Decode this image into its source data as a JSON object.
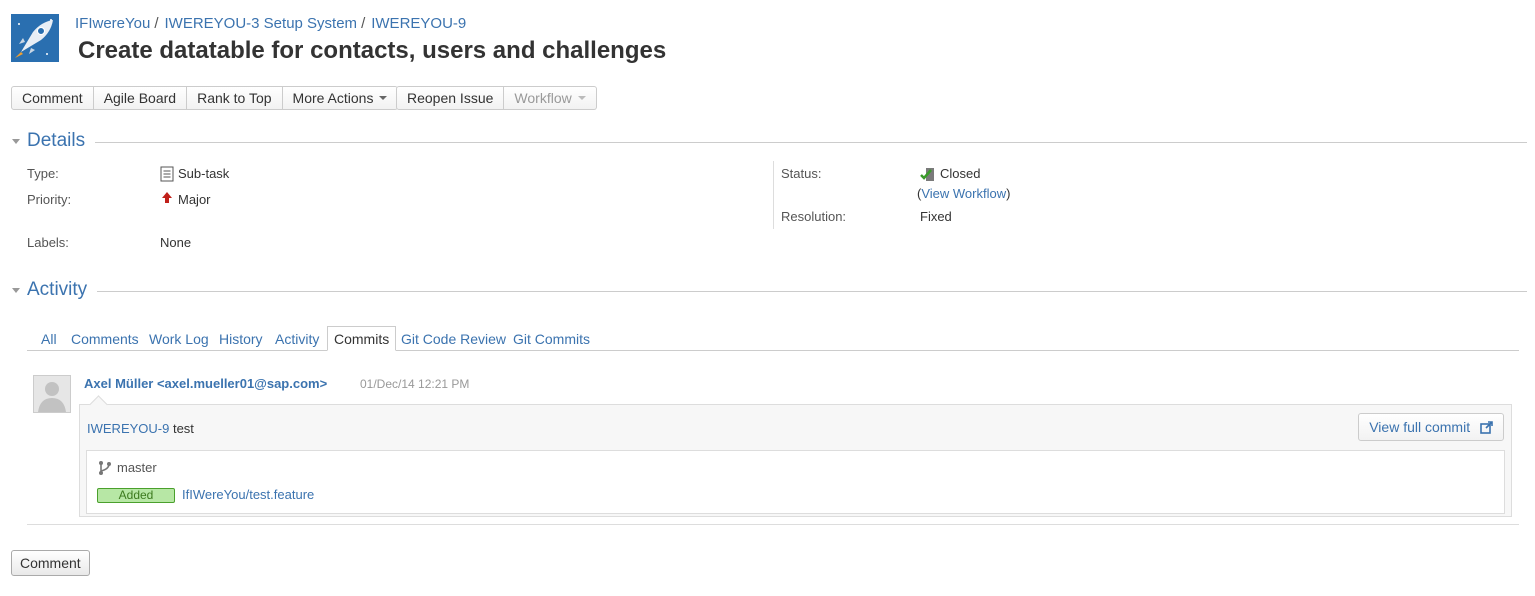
{
  "header": {
    "breadcrumbs": [
      "IFIwereYou",
      "IWEREYOU-3 Setup System",
      "IWEREYOU-9"
    ],
    "separator": "/",
    "title": "Create datatable for contacts, users and challenges"
  },
  "toolbar": {
    "group1": [
      "Comment",
      "Agile Board",
      "Rank to Top",
      "More Actions"
    ],
    "group2": [
      "Reopen Issue",
      "Workflow"
    ]
  },
  "details": {
    "heading": "Details",
    "type_label": "Type:",
    "type_value": "Sub-task",
    "priority_label": "Priority:",
    "priority_value": "Major",
    "labels_label": "Labels:",
    "labels_value": "None",
    "status_label": "Status:",
    "status_value": "Closed",
    "view_workflow_open": "(",
    "view_workflow": "View Workflow",
    "view_workflow_close": ")",
    "resolution_label": "Resolution:",
    "resolution_value": "Fixed"
  },
  "activity": {
    "heading": "Activity",
    "tabs": [
      "All",
      "Comments",
      "Work Log",
      "History",
      "Activity",
      "Commits",
      "Git Code Review",
      "Git Commits"
    ],
    "active_tab": "Commits"
  },
  "commit": {
    "author": "Axel Müller <axel.mueller01@sap.com>",
    "date": "01/Dec/14 12:21 PM",
    "issue_key": "IWEREYOU-9",
    "message": " test",
    "view_full": "View full commit",
    "branch": "master",
    "change_type": "Added",
    "file": "IfIWereYou/test.feature"
  },
  "footer": {
    "comment_button": "Comment"
  },
  "colors": {
    "link": "#3b73af",
    "added_bg": "#b7e7a5",
    "added_border": "#4aa02c"
  }
}
